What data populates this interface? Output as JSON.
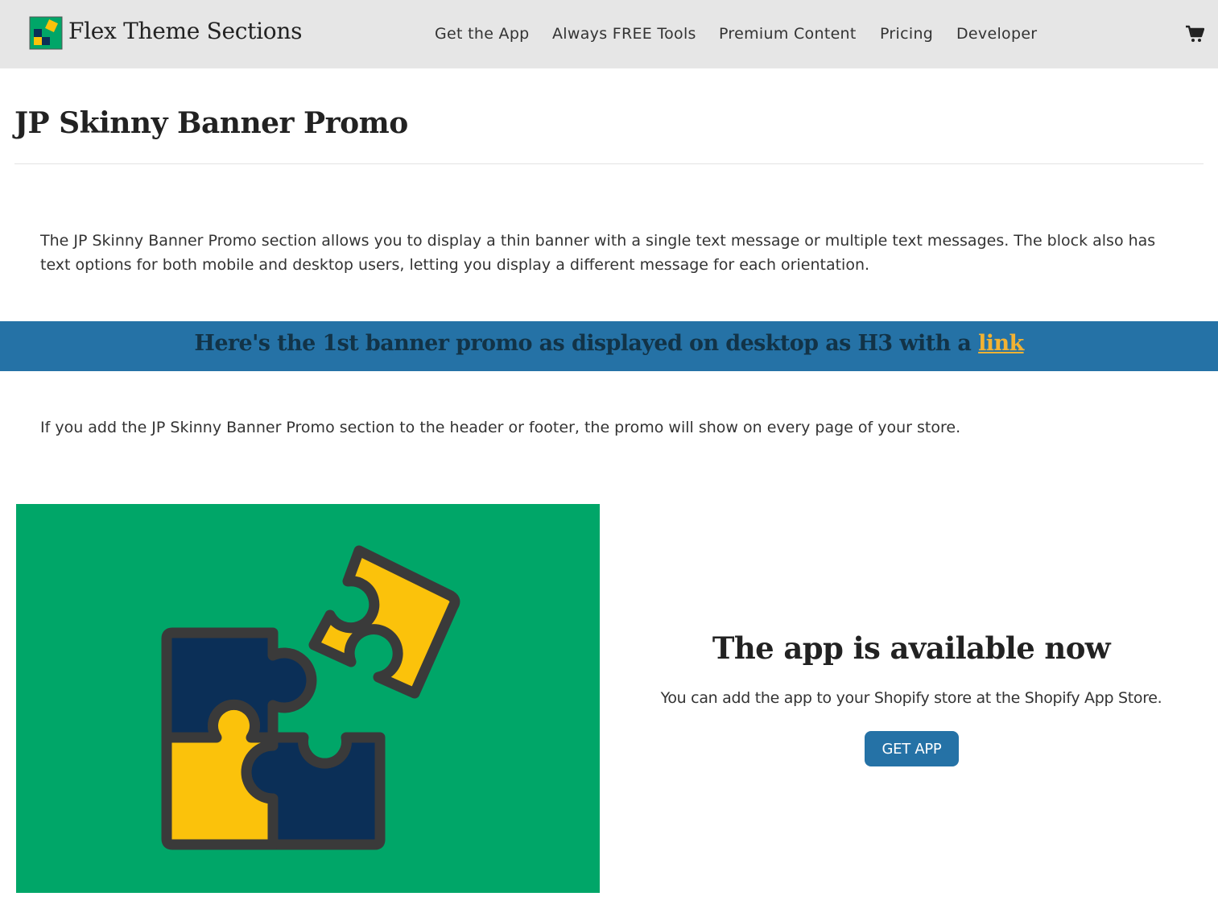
{
  "header": {
    "brand": "Flex Theme Sections",
    "logo_icon": "puzzle-logo-icon",
    "nav": [
      {
        "label": "Get the App"
      },
      {
        "label": "Always FREE Tools"
      },
      {
        "label": "Premium Content"
      },
      {
        "label": "Pricing"
      },
      {
        "label": "Developer"
      }
    ],
    "cart_icon": "cart-icon"
  },
  "page": {
    "title": "JP Skinny Banner Promo",
    "intro": "The JP Skinny Banner Promo section allows you to display a thin banner with a single text message or multiple text messages. The block also has text options for both mobile and desktop users, letting you display a different message for each orientation."
  },
  "promo": {
    "text": "Here's the 1st banner promo as displayed on desktop as H3 with a",
    "link_label": "link",
    "background": "#2572a6",
    "link_color": "#f2b233"
  },
  "note": "If you add the JP Skinny Banner Promo section to the header or footer, the promo will show on every page of your store.",
  "app_section": {
    "image_icon": "puzzle-pieces-icon",
    "heading": "The app is available now",
    "description": "You can add the app to your Shopify store at the Shopify App Store.",
    "button_label": "GET APP",
    "panel_color": "#00a668",
    "piece_colors": [
      "#0b2f57",
      "#fbc20b"
    ]
  }
}
